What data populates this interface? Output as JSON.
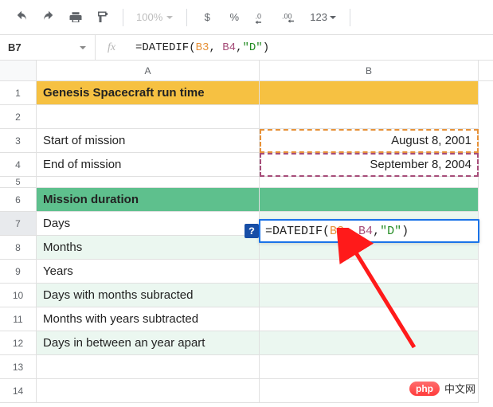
{
  "toolbar": {
    "zoom": "100%",
    "buttons": {
      "currency": "$",
      "percent": "%",
      "dec_dec": ".0",
      "inc_dec": ".00",
      "more_formats": "123"
    }
  },
  "name_box": "B7",
  "fx_label": "fx",
  "formula": {
    "prefix": "=DATEDIF(",
    "arg1": "B3",
    "comma1": ", ",
    "arg2": "B4",
    "comma2": ",",
    "arg3": "\"D\"",
    "suffix": ")"
  },
  "columns": {
    "A": "A",
    "B": "B"
  },
  "rows": {
    "1": {
      "A": "Genesis Spacecraft run time",
      "B": ""
    },
    "2": {
      "A": "",
      "B": ""
    },
    "3": {
      "A": "Start of mission",
      "B": "August 8, 2001"
    },
    "4": {
      "A": "End of mission",
      "B": "September 8, 2004"
    },
    "5": {
      "A": "",
      "B": ""
    },
    "6": {
      "A": "Mission duration",
      "B": ""
    },
    "7": {
      "A": "Days",
      "B_formula": true
    },
    "8": {
      "A": "Months",
      "B": ""
    },
    "9": {
      "A": "Years",
      "B": ""
    },
    "10": {
      "A": "Days with months subracted",
      "B": ""
    },
    "11": {
      "A": "Months with years subtracted",
      "B": ""
    },
    "12": {
      "A": "Days in between an year apart",
      "B": ""
    },
    "13": {
      "A": "",
      "B": ""
    },
    "14": {
      "A": "",
      "B": ""
    }
  },
  "hint_icon": "?",
  "watermark": {
    "badge": "php",
    "text": "中文网"
  }
}
